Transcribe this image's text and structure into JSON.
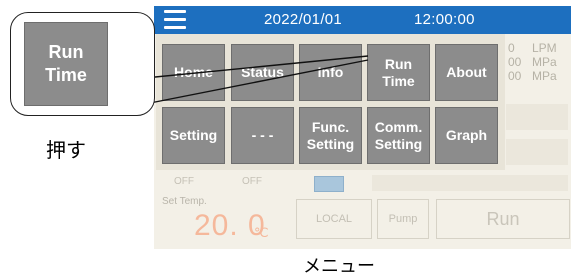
{
  "statusbar": {
    "date": "2022/01/01",
    "time": "12:00:00"
  },
  "readings": [
    {
      "digit": "0",
      "unit": "LPM"
    },
    {
      "digit": "00",
      "unit": "MPa"
    },
    {
      "digit": "00",
      "unit": "MPa"
    }
  ],
  "background_panel": {
    "off_label_1": "OFF",
    "off_label_2": "OFF",
    "set_temp_label": "Set Temp.",
    "set_temp_value": "20. 0",
    "set_temp_unit": "℃",
    "local_button": "LOCAL",
    "pump_button": "Pump",
    "run_button": "Run"
  },
  "menu": {
    "row1": [
      {
        "line1": "Home",
        "line2": ""
      },
      {
        "line1": "Status",
        "line2": ""
      },
      {
        "line1": "Info",
        "line2": ""
      },
      {
        "line1": "Run",
        "line2": "Time"
      },
      {
        "line1": "About",
        "line2": ""
      }
    ],
    "row2": [
      {
        "line1": "Setting",
        "line2": ""
      },
      {
        "line1": "- - -",
        "line2": ""
      },
      {
        "line1": "Func.",
        "line2": "Setting"
      },
      {
        "line1": "Comm.",
        "line2": "Setting"
      },
      {
        "line1": "Graph",
        "line2": ""
      }
    ]
  },
  "callout": {
    "line1": "Run",
    "line2": "Time",
    "press_label": "押す"
  },
  "caption": "メニュー",
  "colors": {
    "titlebar": "#1d6fbf",
    "menu_button": "#8c8c8c",
    "set_temp": "#f5b89b"
  }
}
